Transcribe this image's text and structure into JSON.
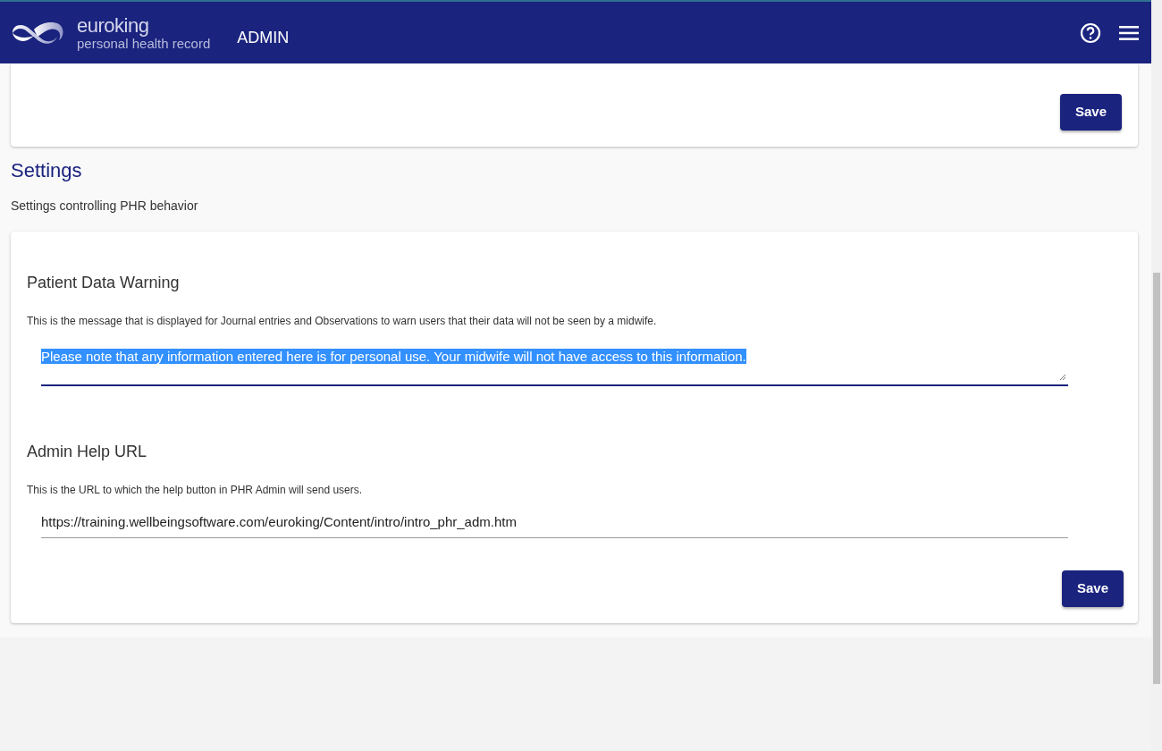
{
  "header": {
    "brand": "euroking",
    "tagline": "personal health record",
    "section": "ADMIN"
  },
  "top_card": {
    "button": "Save"
  },
  "settings": {
    "title": "Settings",
    "subtitle": "Settings controlling PHR behavior",
    "items": [
      {
        "kind": "textarea",
        "label": "Patient Data Warning",
        "description": "This is the message that is displayed for Journal entries and Observations to warn users that their data will not be seen by a midwife.",
        "value": "Please note that any information entered here is for personal use. Your midwife will not have access to this information.",
        "focused": true,
        "text_selected": true
      },
      {
        "kind": "input",
        "label": "Admin Help URL",
        "description": "This is the URL to which the help button in PHR Admin will send users.",
        "value": "https://training.wellbeingsoftware.com/euroking/Content/intro/intro_phr_adm.htm",
        "focused": false,
        "text_selected": false
      }
    ],
    "button": "Save"
  }
}
